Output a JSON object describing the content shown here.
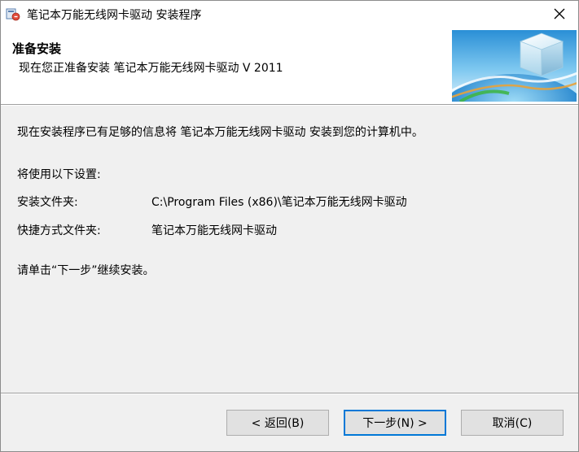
{
  "window": {
    "title": "笔记本万能无线网卡驱动 安装程序",
    "close_symbol": "✕"
  },
  "header": {
    "title": "准备安装",
    "subtitle": "现在您正准备安装 笔记本万能无线网卡驱动 V 2011"
  },
  "body": {
    "intro": "现在安装程序已有足够的信息将 笔记本万能无线网卡驱动 安装到您的计算机中。",
    "settings_heading": "将使用以下设置:",
    "install_folder_label": "安装文件夹:",
    "install_folder_value": "C:\\Program Files (x86)\\笔记本万能无线网卡驱动",
    "shortcut_folder_label": "快捷方式文件夹:",
    "shortcut_folder_value": "笔记本万能无线网卡驱动",
    "continue_hint": "请单击“下一步”继续安装。"
  },
  "buttons": {
    "back": "< 返回(B)",
    "next": "下一步(N) >",
    "cancel": "取消(C)"
  },
  "icons": {
    "app": "installer-app-icon",
    "close": "close-icon",
    "header_graphic": "globe-box-graphic"
  },
  "colors": {
    "default_button_border": "#0078d7",
    "background": "#f0f0f0"
  }
}
